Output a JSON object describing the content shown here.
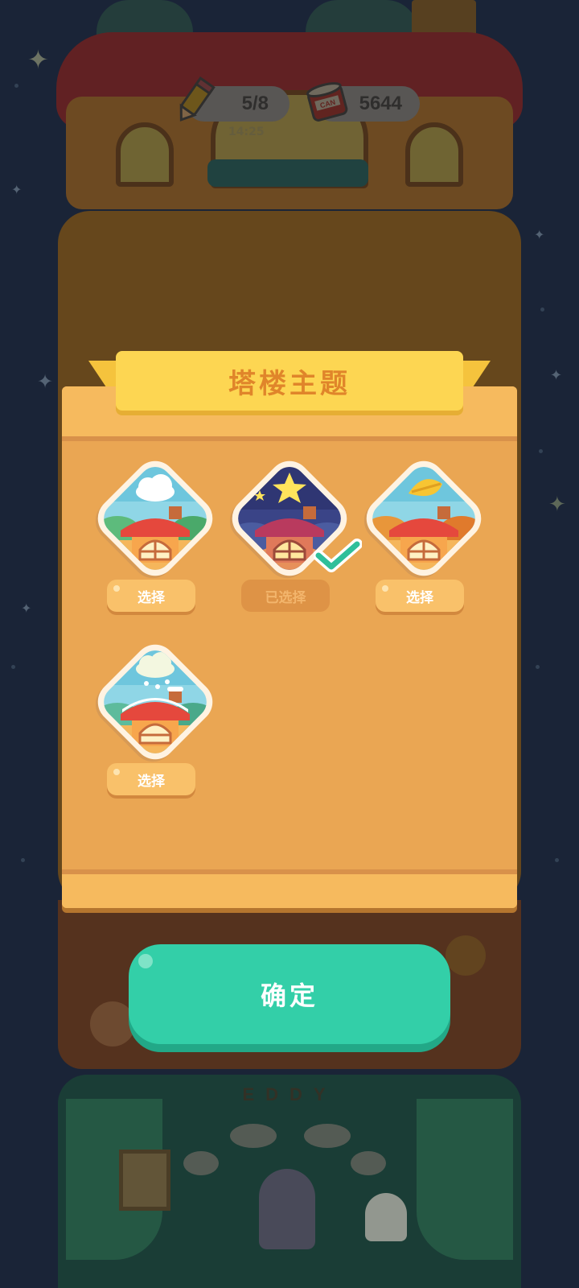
{
  "hud": {
    "pencil_count": "5/8",
    "pencil_timer": "14:25",
    "coins": "5644",
    "can_label": "CAN"
  },
  "background": {
    "sign": "EDDY"
  },
  "dialog": {
    "title": "塔楼主题",
    "themes": [
      {
        "name": "day-cloud-theme",
        "button_label": "选择",
        "selected": false
      },
      {
        "name": "night-star-theme",
        "button_label": "已选择",
        "selected": true
      },
      {
        "name": "autumn-leaf-theme",
        "button_label": "选择",
        "selected": false
      },
      {
        "name": "snow-cloud-theme",
        "button_label": "选择",
        "selected": false
      }
    ],
    "confirm_label": "确定"
  },
  "colors": {
    "accent_green": "#33cfa8",
    "dialog_orange": "#eaa653",
    "ribbon_yellow": "#fdd652",
    "title_orange": "#e0852a"
  }
}
